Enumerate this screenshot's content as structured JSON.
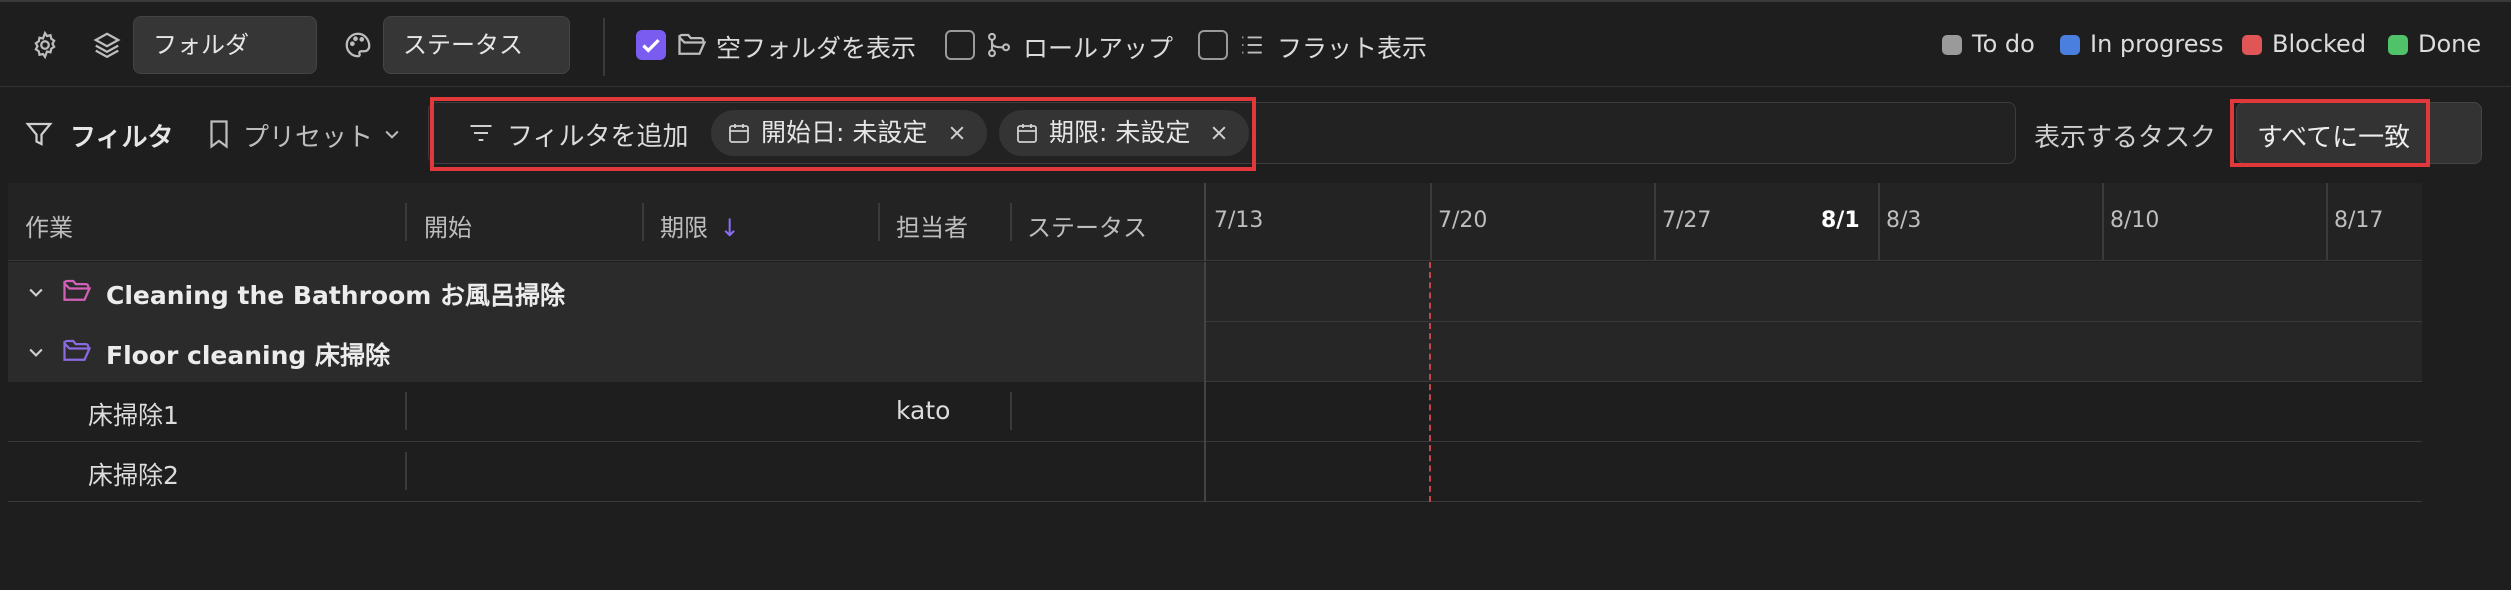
{
  "toolbar": {
    "group_by_value": "フォルダ",
    "color_by_value": "ステータス",
    "show_empty_folders_label": "空フォルダを表示",
    "show_empty_folders_checked": true,
    "rollup_label": "ロールアップ",
    "rollup_checked": false,
    "flat_view_label": "フラット表示",
    "flat_view_checked": false,
    "legend": [
      {
        "label": "To do",
        "color": "#9a9a9a"
      },
      {
        "label": "In progress",
        "color": "#4a7fe0"
      },
      {
        "label": "Blocked",
        "color": "#e05555"
      },
      {
        "label": "Done",
        "color": "#4fc26a"
      }
    ],
    "accent_color": "#7b5cf0"
  },
  "filterbar": {
    "filter_label": "フィルタ",
    "preset_label": "プリセット",
    "add_filter_label": "フィルタを追加",
    "chips": [
      {
        "label": "開始日: 未設定"
      },
      {
        "label": "期限: 未設定"
      }
    ],
    "show_tasks_label": "表示するタスク",
    "match_value": "すべてに一致",
    "highlight_color": "#e0383b"
  },
  "grid": {
    "columns": [
      "作業",
      "開始",
      "期限",
      "担当者",
      "ステータス"
    ],
    "sort_indicator": "↓",
    "timeline_dates": [
      "7/13",
      "7/20",
      "7/27",
      "8/1",
      "8/3",
      "8/10",
      "8/17"
    ],
    "today_label": "8/1",
    "today_line_color": "#c0484a",
    "groups": [
      {
        "name": "Cleaning the Bathroom お風呂掃除",
        "folder_color": "#d25fb8"
      },
      {
        "name": "Floor cleaning 床掃除",
        "folder_color": "#8a6ae0"
      }
    ],
    "tasks": [
      {
        "name": "床掃除1",
        "start": "",
        "due": "",
        "assignee": "kato",
        "status": ""
      },
      {
        "name": "床掃除2",
        "start": "",
        "due": "",
        "assignee": "",
        "status": ""
      }
    ]
  }
}
